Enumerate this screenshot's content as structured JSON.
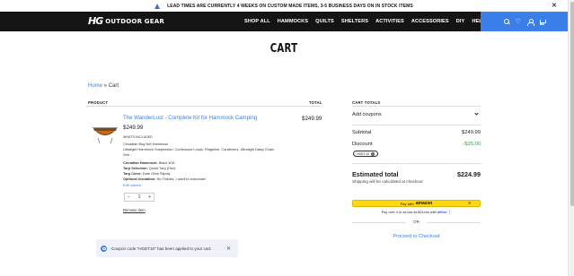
{
  "announcement": {
    "text": "LEAD TIMES ARE CURRENTLY 4 WEEKS ON CUSTOM MADE ITEMS, 3-5 BUSINESS DAYS ON IN STOCK ITEMS",
    "close": "✕"
  },
  "brand": {
    "mark": "HG",
    "name": "OUTDOOR GEAR"
  },
  "nav": [
    "SHOP ALL",
    "HAMMOCKS",
    "QUILTS",
    "SHELTERS",
    "ACTIVITIES",
    "ACCESSORIES",
    "DIY",
    "HELP"
  ],
  "page": {
    "title": "CART"
  },
  "breadcrumb": {
    "home": "Home",
    "sep": " » ",
    "current": "Cart"
  },
  "table": {
    "product_header": "PRODUCT",
    "total_header": "TOTAL"
  },
  "item": {
    "name": "The WanderLust - Complete Kit for Hammock Camping",
    "price": "$249.99",
    "total": "$249.99",
    "included_heading": "WHAT'S INCLUDED",
    "included": [
      "Circadian Bug Net Hammock",
      "Ultralight Hammock Suspension: Continuous Loops, Ridgeline, Carabiners, Ultralight Daisy Chain",
      "See..."
    ],
    "options": [
      {
        "label": "Circadian Hammock:",
        "value": "Black 40D"
      },
      {
        "label": "Tarp Selection:",
        "value": "Quest Tarp (Hex)"
      },
      {
        "label": "Tarp Color:",
        "value": "Dark Olive Silpoly"
      },
      {
        "label": "Optional Insulation:",
        "value": "No Thanks, I want to customize"
      }
    ],
    "edit": "Edit options",
    "qty": "1",
    "qty_minus": "−",
    "qty_plus": "+",
    "remove": "Remove item"
  },
  "totals": {
    "header": "CART TOTALS",
    "coupons": "Add coupons",
    "subtotal_label": "Subtotal",
    "subtotal": "$249.99",
    "discount_label": "Discount",
    "discount": "-$25.00",
    "coupon_code": "HGET10",
    "estimated_label": "Estimated total",
    "estimated": "$224.99",
    "shipping_note": "Shipping will be calculated at checkout",
    "amazon_pre": "Pay with",
    "amazon_brand": "amazon",
    "affirm_text": "Pay over 4 or as low as $21/mo with",
    "affirm_brand": "affirm",
    "affirm_info": "ⓘ",
    "or": "OR",
    "checkout": "Proceed to Checkout"
  },
  "toast": {
    "message": "Coupon code \"HGET10\" has been applied to your cart.",
    "close": "✕"
  }
}
